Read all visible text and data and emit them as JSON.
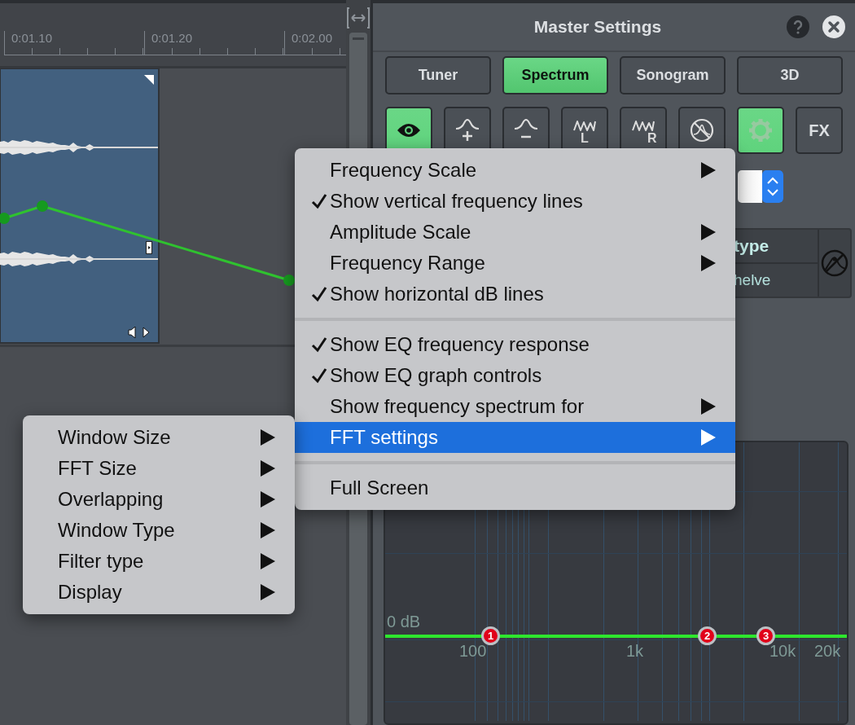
{
  "timeline": {
    "ruler_labels": [
      "0:01.10",
      "0:01.20",
      "0:02.00"
    ]
  },
  "panel": {
    "title": "Master Settings",
    "tabs": [
      {
        "label": "Tuner",
        "selected": false
      },
      {
        "label": "Spectrum",
        "selected": true
      },
      {
        "label": "Sonogram",
        "selected": false
      },
      {
        "label": "3D",
        "selected": false
      }
    ],
    "tools": [
      {
        "kind": "eye",
        "on": true
      },
      {
        "kind": "peak-plus",
        "on": false
      },
      {
        "kind": "peak-minus",
        "on": false
      },
      {
        "kind": "wave",
        "label": "L",
        "on": false
      },
      {
        "kind": "wave",
        "label": "R",
        "on": false
      },
      {
        "kind": "bypass",
        "on": false
      },
      {
        "kind": "gear",
        "on": true
      },
      {
        "kind": "text",
        "label": "FX",
        "on": false
      }
    ],
    "table": {
      "header": "type",
      "cell": "helve"
    },
    "graph": {
      "db_label": "0 dB",
      "freq_labels": [
        "100",
        "1k",
        "10k",
        "20k"
      ],
      "nodes": [
        {
          "label": "1"
        },
        {
          "label": "2"
        },
        {
          "label": "3"
        }
      ]
    }
  },
  "context_menu": [
    {
      "kind": "item",
      "label": "Frequency Scale",
      "checked": false,
      "submenu": true,
      "selected": false
    },
    {
      "kind": "item",
      "label": "Show vertical frequency lines",
      "checked": true,
      "submenu": false,
      "selected": false
    },
    {
      "kind": "item",
      "label": "Amplitude Scale",
      "checked": false,
      "submenu": true,
      "selected": false
    },
    {
      "kind": "item",
      "label": "Frequency Range",
      "checked": false,
      "submenu": true,
      "selected": false
    },
    {
      "kind": "item",
      "label": "Show horizontal dB lines",
      "checked": true,
      "submenu": false,
      "selected": false
    },
    {
      "kind": "separator"
    },
    {
      "kind": "item",
      "label": "Show EQ frequency response",
      "checked": true,
      "submenu": false,
      "selected": false
    },
    {
      "kind": "item",
      "label": "Show EQ graph controls",
      "checked": true,
      "submenu": false,
      "selected": false
    },
    {
      "kind": "item",
      "label": "Show frequency spectrum for",
      "checked": false,
      "submenu": true,
      "selected": false
    },
    {
      "kind": "item",
      "label": "FFT settings",
      "checked": false,
      "submenu": true,
      "selected": true
    },
    {
      "kind": "separator"
    },
    {
      "kind": "item",
      "label": "Full Screen",
      "checked": false,
      "submenu": false,
      "selected": false
    }
  ],
  "submenu": [
    {
      "kind": "item",
      "label": "Window Size",
      "checked": false,
      "submenu": true,
      "selected": false
    },
    {
      "kind": "item",
      "label": "FFT Size",
      "checked": false,
      "submenu": true,
      "selected": false
    },
    {
      "kind": "item",
      "label": "Overlapping",
      "checked": false,
      "submenu": true,
      "selected": false
    },
    {
      "kind": "item",
      "label": "Window Type",
      "checked": false,
      "submenu": true,
      "selected": false
    },
    {
      "kind": "item",
      "label": "Filter type",
      "checked": false,
      "submenu": true,
      "selected": false
    },
    {
      "kind": "item",
      "label": "Display",
      "checked": false,
      "submenu": true,
      "selected": false
    }
  ]
}
